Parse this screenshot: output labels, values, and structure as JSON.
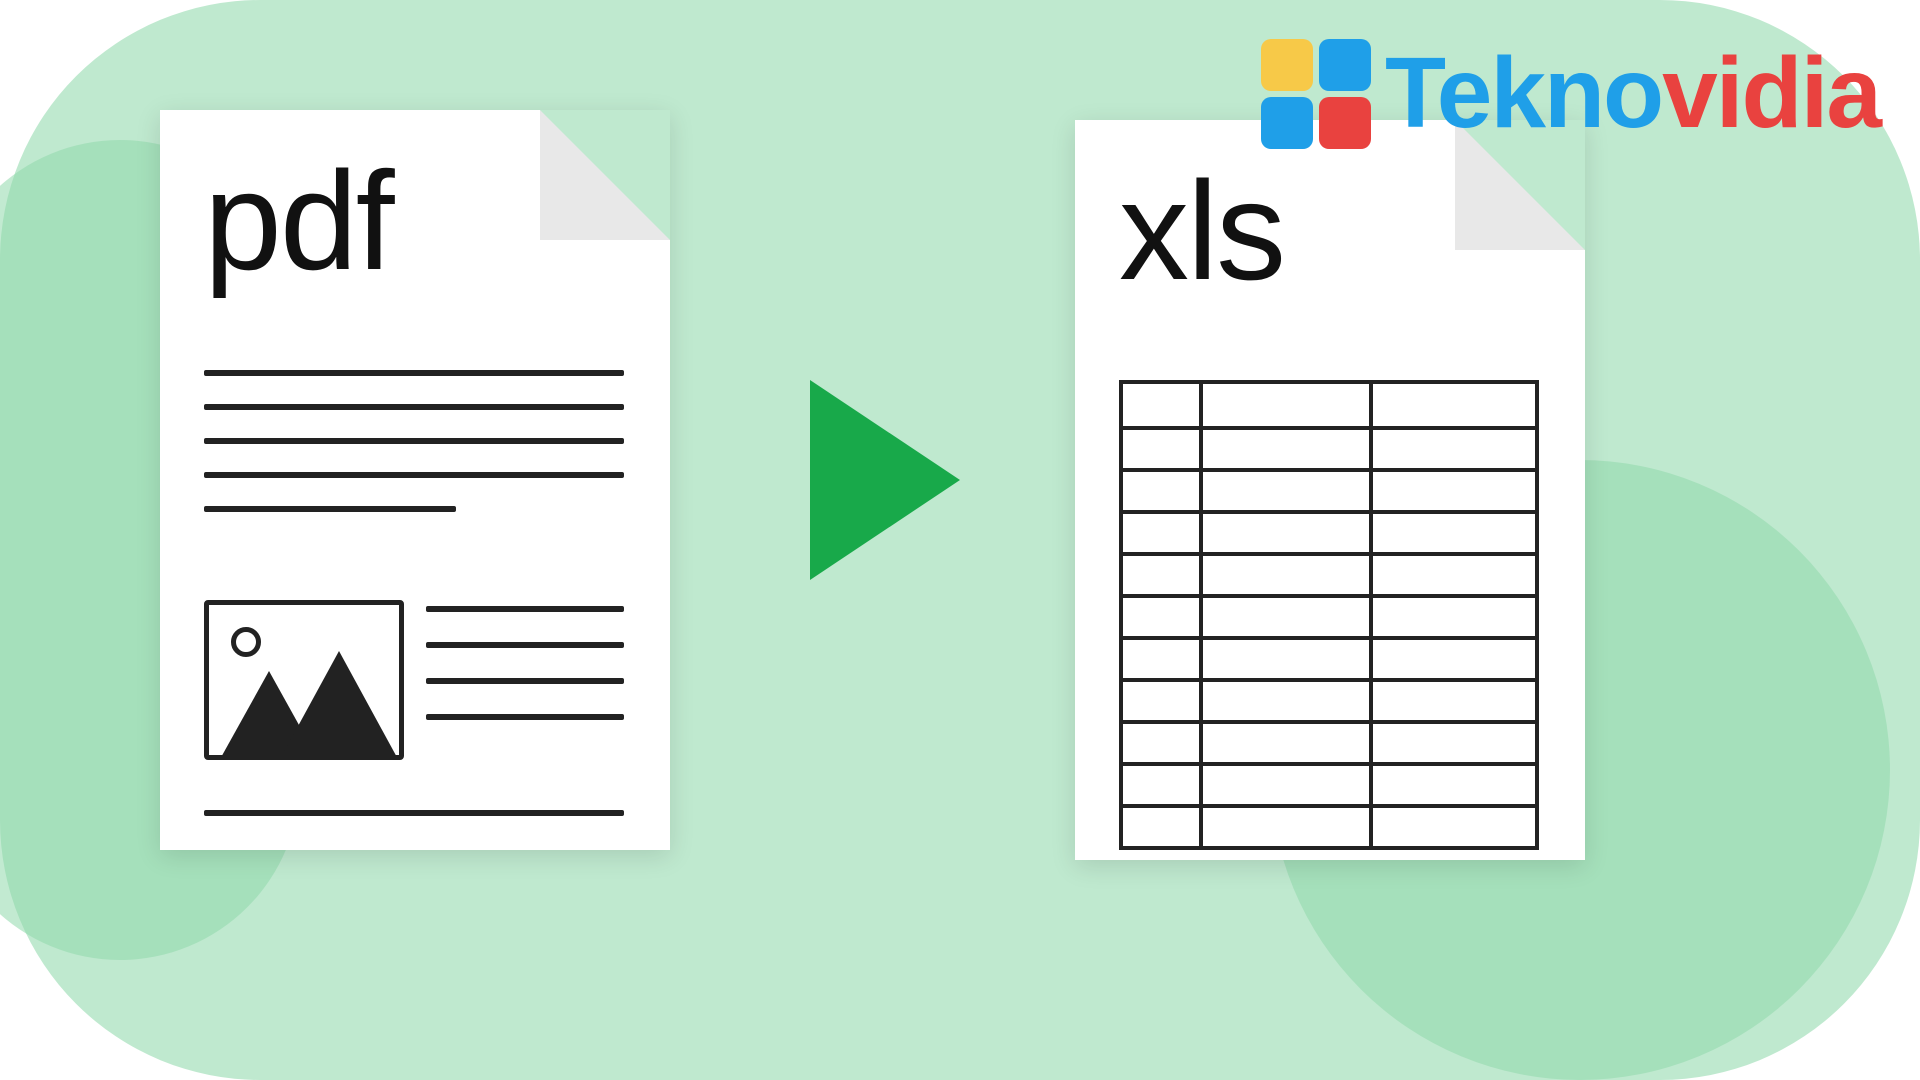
{
  "left_doc": {
    "label": "pdf"
  },
  "right_doc": {
    "label": "xls"
  },
  "logo": {
    "part1": "Tekno",
    "part2": "vidia"
  },
  "colors": {
    "background": "#bfe9cf",
    "accent_green": "#18a94a",
    "logo_blue": "#1f9fe8",
    "logo_red": "#e9423f",
    "logo_yellow": "#f7c948"
  }
}
